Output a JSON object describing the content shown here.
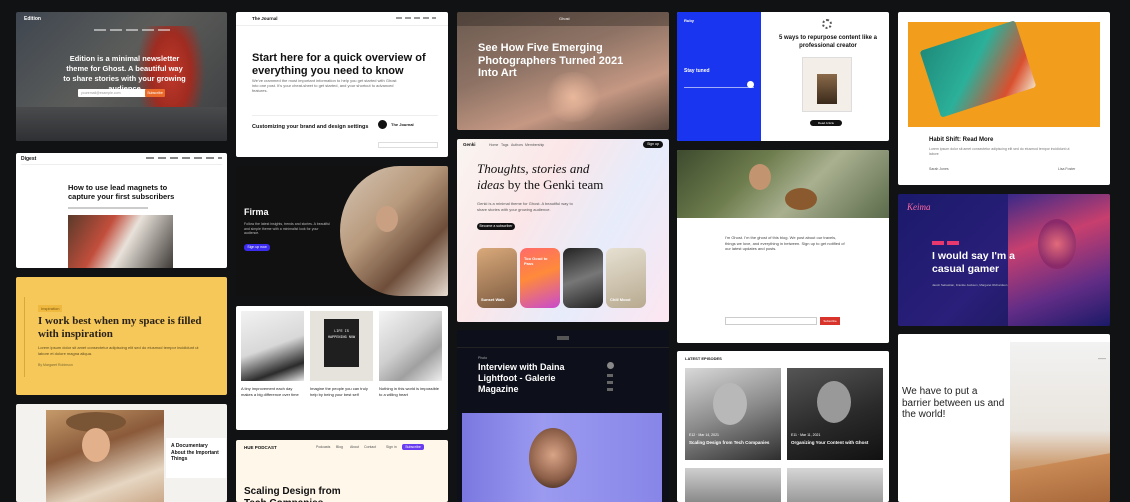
{
  "edition": {
    "logo": "Edition",
    "headline": "Edition is a minimal newsletter theme for Ghost. A beautiful way to share stories with your growing audience",
    "email_placeholder": "youremail@example.com",
    "subscribe_label": "Subscribe"
  },
  "journal": {
    "logo": "The Journal",
    "headline": "Start here for a quick overview of everything you need to know",
    "body": "We've crammed the most important information to help you get started with Ghost into one post. It's your cheat-sheet to get started, and your shortcut to advanced features.",
    "article_title": "Customizing your brand and design settings",
    "sidebar_title": "The Journal"
  },
  "photo": {
    "headline": "See How Five Emerging Photographers Turned 2021 Into Art",
    "logo": "Ghost"
  },
  "ruby": {
    "brand": "Ruby",
    "subscribe_title": "Stay tuned",
    "headline": "5 ways to repurpose content like a professional creator",
    "button": "Read Article"
  },
  "book": {
    "title": "Habit Shift: Read More",
    "body": "Lorem ipsum dolor sit amet consectetur adipiscing elit sed do eiusmod tempor incididunt ut labore",
    "author_a": "Sarah Jones",
    "author_b": "Lisa Foster"
  },
  "digest": {
    "logo": "Digest",
    "headline": "How to use lead magnets to capture your first subscribers"
  },
  "firma": {
    "logo": "Firma",
    "body": "Follow the latest insights, trends and stories. A beautiful and simple theme with a minimalist look for your audience.",
    "button": "Sign up now"
  },
  "genki": {
    "logo": "Genki",
    "nav": [
      "Home",
      "Tags",
      "Authors",
      "Membership"
    ],
    "signin": "Sign up",
    "headline_italic": "Thoughts, stories and ideas",
    "headline_rest": "by the Genki team",
    "body": "Genki is a minimal theme for Ghost. A beautiful way to share stories with your growing audience.",
    "button": "Become a subscriber",
    "cards": [
      "Sunset Walk",
      "Too Good to Pass",
      "",
      "Chill Mood"
    ]
  },
  "dog": {
    "body": "I'm Ghost. I'm the ghost of this blog. We post about our travels, things we love, and everything in between. Sign up to get notified of our latest updates and posts.",
    "button": "Subscribe"
  },
  "keima": {
    "logo": "Keima",
    "headline": "I would say I'm a casual gamer",
    "authors": "Jacob Sebastian, Frankie Jackson, Margaret Richardson"
  },
  "yellow": {
    "tag": "Inspiration",
    "headline": "I work best when my space is filled with inspiration",
    "body": "Lorem ipsum dolor sit amet consectetur adipiscing elit sed do eiusmod tempor incididunt ut labore et dolore magna aliqua.",
    "author": "By Margaret Robinson"
  },
  "grid": {
    "captions": [
      "A tiny improvement each day makes a big difference over time",
      "Imagine the people you can truly help by being your best self",
      "Nothing in this world is impossible to a willing heart"
    ],
    "board_text": "LIFE IS HAPPENING NOW"
  },
  "interview": {
    "tag": "Photo",
    "headline": "Interview with Daina Lightfoot - Galerie Magazine"
  },
  "barrier": {
    "headline": "We have to put a barrier between us and the world!",
    "mark": "—"
  },
  "doc": {
    "headline": "A Documentary About the Important Things"
  },
  "hue": {
    "logo": "HUE PODCAST",
    "nav": [
      "Podcasts",
      "Blog",
      "About",
      "Contact"
    ],
    "signin": "Sign in",
    "subscribe": "Subscribe",
    "headline": "Scaling Design from Tech Companies"
  },
  "episodes": {
    "heading": "LATEST EPISODES",
    "items": [
      {
        "meta": "E12 · Mar 14, 2021",
        "title": "Scaling Design from Tech Companies"
      },
      {
        "meta": "E11 · Mar 11, 2021",
        "title": "Organizing Your Content with Ghost"
      }
    ]
  },
  "colors": {
    "wall_bg": "#111214",
    "edition_orange": "#ea6a2a",
    "ruby_blue": "#1a35f0",
    "keima_navy": "#1b1a6b",
    "keima_pink": "#e8386e",
    "yellow_bg": "#f6c85a",
    "interview_bg": "#0d0f1a",
    "firma_bg": "#111111",
    "digest_bg": "#ffffff",
    "hue_bg": "#fff7ea"
  }
}
